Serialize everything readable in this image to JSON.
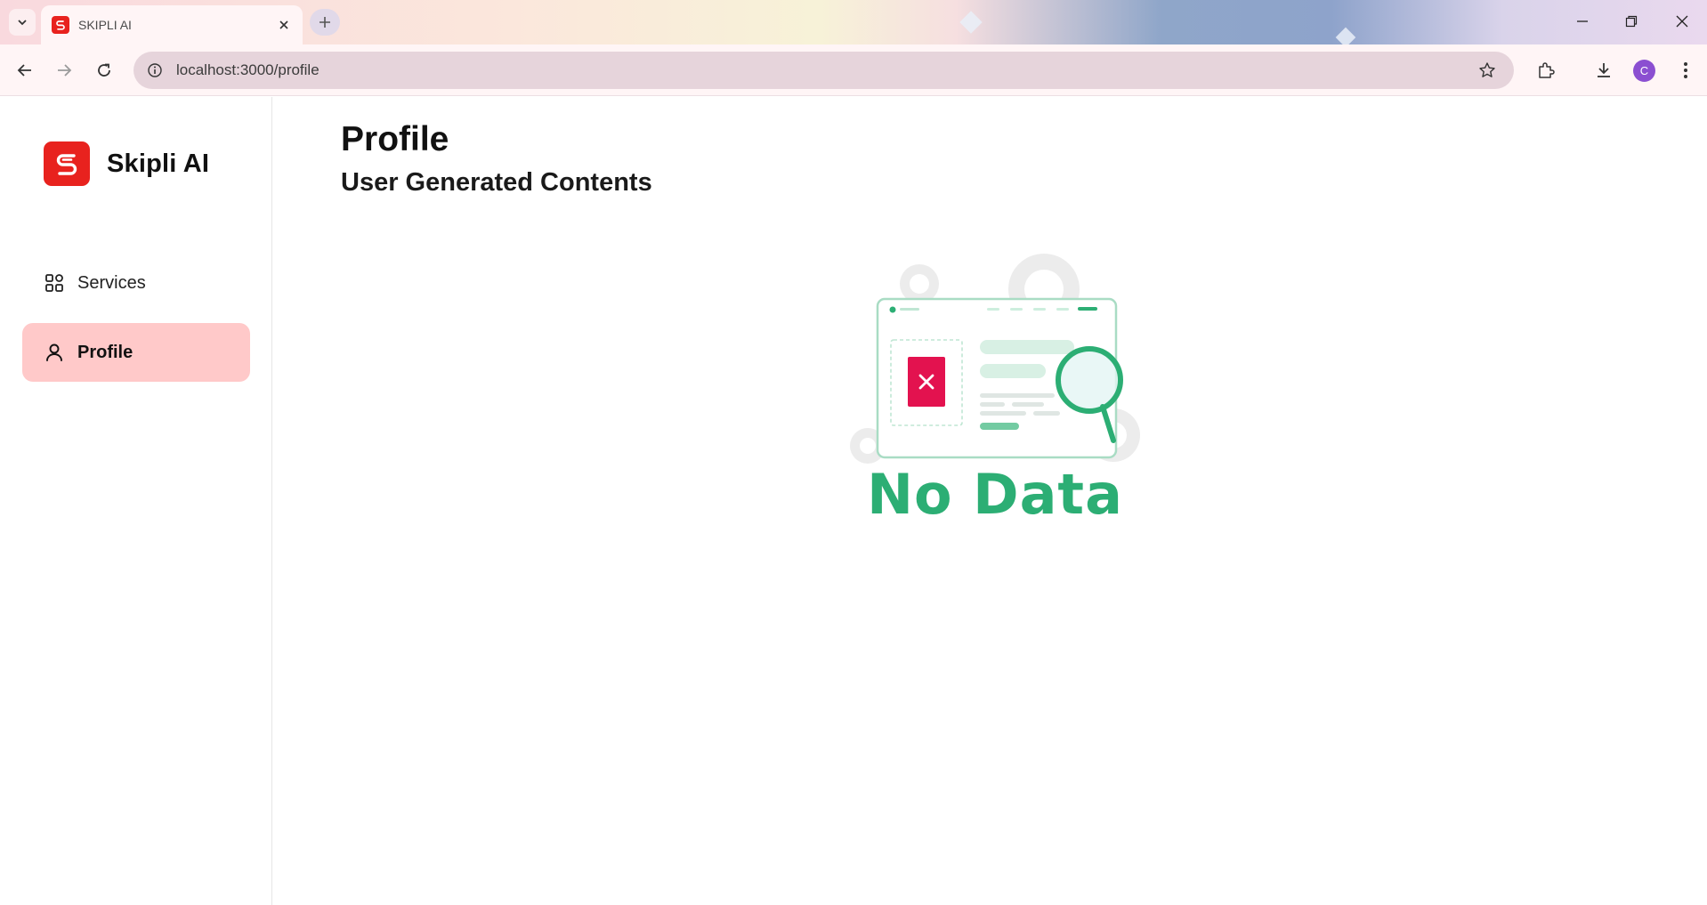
{
  "browser": {
    "tab_title": "SKIPLI AI",
    "url": "localhost:3000/profile",
    "profile_initial": "C"
  },
  "app": {
    "brand_name": "Skipli AI",
    "brand_color": "#e8221e",
    "nav": [
      {
        "label": "Services",
        "icon": "grid-icon",
        "active": false
      },
      {
        "label": "Profile",
        "icon": "user-icon",
        "active": true
      }
    ],
    "active_nav_color": "#ffc9c9"
  },
  "main": {
    "title": "Profile",
    "subtitle": "User Generated Contents",
    "empty_state": {
      "text": "No Data",
      "accent": "#2cae74",
      "icon": "no-data-illustration"
    }
  }
}
